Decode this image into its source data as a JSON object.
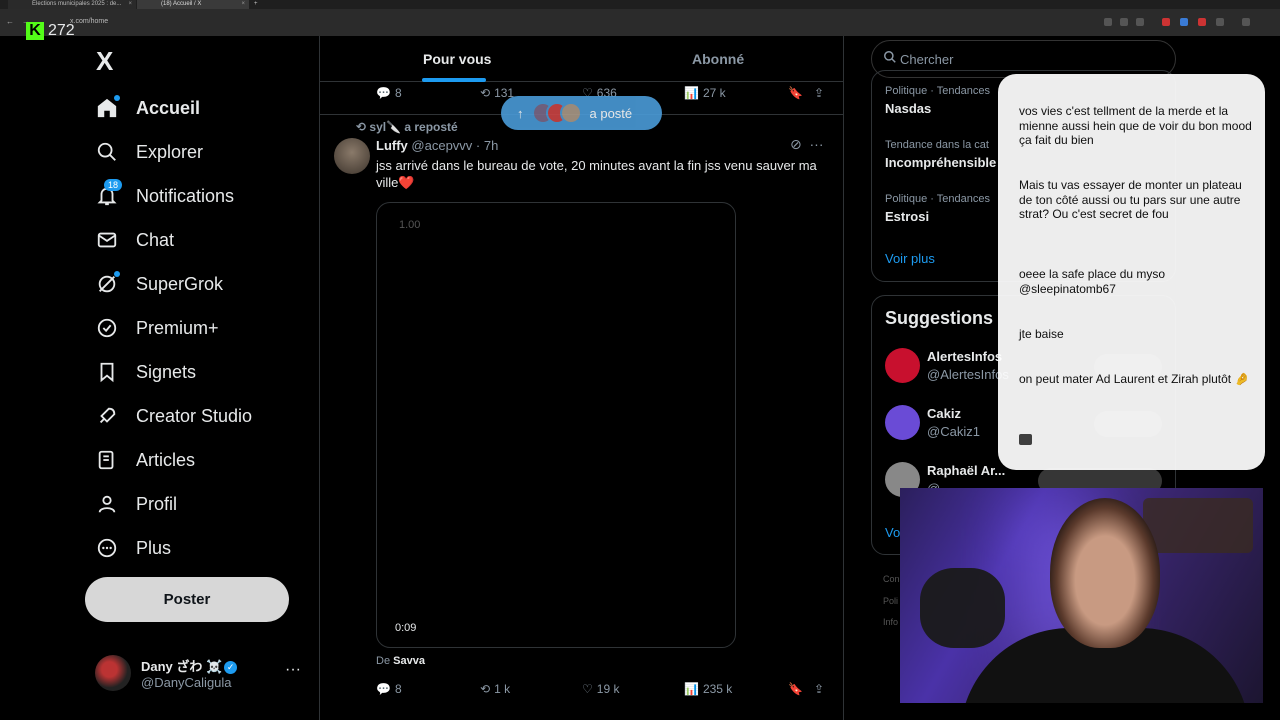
{
  "browser": {
    "tabs": [
      {
        "label": "Élections municipales 2025 : de..."
      },
      {
        "label": "(18) Accueil / X"
      }
    ],
    "url": "x.com/home"
  },
  "kick": {
    "viewer_count": "272"
  },
  "nav": {
    "logo": "X",
    "items": [
      {
        "label": "Accueil",
        "icon": "home-icon"
      },
      {
        "label": "Explorer",
        "icon": "search-icon"
      },
      {
        "label": "Notifications",
        "icon": "bell-icon",
        "badge": "18"
      },
      {
        "label": "Chat",
        "icon": "mail-icon"
      },
      {
        "label": "SuperGrok",
        "icon": "grok-icon"
      },
      {
        "label": "Premium+",
        "icon": "verified-icon"
      },
      {
        "label": "Signets",
        "icon": "bookmark-icon"
      },
      {
        "label": "Creator Studio",
        "icon": "rocket-icon"
      },
      {
        "label": "Articles",
        "icon": "article-icon"
      },
      {
        "label": "Profil",
        "icon": "person-icon"
      },
      {
        "label": "Plus",
        "icon": "more-circle-icon"
      }
    ],
    "post_label": "Poster",
    "account": {
      "name": "Dany ざわ ☠️",
      "handle": "@DanyCaligula"
    }
  },
  "feed": {
    "tabs": [
      "Pour vous",
      "Abonné"
    ],
    "prev_actions": {
      "replies": "8",
      "reposts": "131",
      "likes": "636",
      "views": "27 k"
    },
    "pill": {
      "label": "a posté"
    },
    "tweet": {
      "repost_by": "syl🔪 a reposté",
      "name": "Luffy",
      "handle": "@acepvvv · 7h",
      "text": "jss arrivé dans le bureau de vote, 20 minutes avant la fin jss venu sauver ma ville❤️",
      "video_top": "1.00",
      "video_time": "0:09",
      "from_prefix": "De",
      "from_name": "Savva",
      "actions": {
        "replies": "8",
        "reposts": "1 k",
        "likes": "19 k",
        "views": "235 k"
      }
    }
  },
  "right": {
    "search_placeholder": "Chercher",
    "trends": [
      {
        "context": "Politique · Tendances",
        "title": "Nasdas"
      },
      {
        "context": "Tendance dans la cat",
        "title": "Incompréhensible"
      },
      {
        "context": "Politique · Tendances",
        "title": "Estrosi"
      }
    ],
    "trends_more": "Voir plus",
    "suggestions_title": "Suggestions",
    "suggestions": [
      {
        "name": "AlertesInfos",
        "handle": "@AlertesInfos",
        "color": "#c8102e"
      },
      {
        "name": "Cakiz",
        "handle": "@Cakiz1",
        "color": "#6a4bd6"
      },
      {
        "name": "Raphaël Ar...",
        "handle": "@...",
        "color": "#888888"
      }
    ],
    "suggestions_more": "Vo",
    "footer": [
      "Con",
      "Poli",
      "Info"
    ]
  },
  "chat_overlay": {
    "messages": [
      "vos vies c'est tellment de la merde et la mienne aussi hein que de voir du bon mood ça fait du bien",
      "Mais tu vas essayer de monter un plateau de ton côté aussi ou tu pars sur une autre strat? Ou c'est secret de fou",
      "oeee la safe place du myso @sleepinatomb67",
      "jte baise",
      "on peut mater Ad Laurent et Zirah plutôt 🤌"
    ]
  }
}
